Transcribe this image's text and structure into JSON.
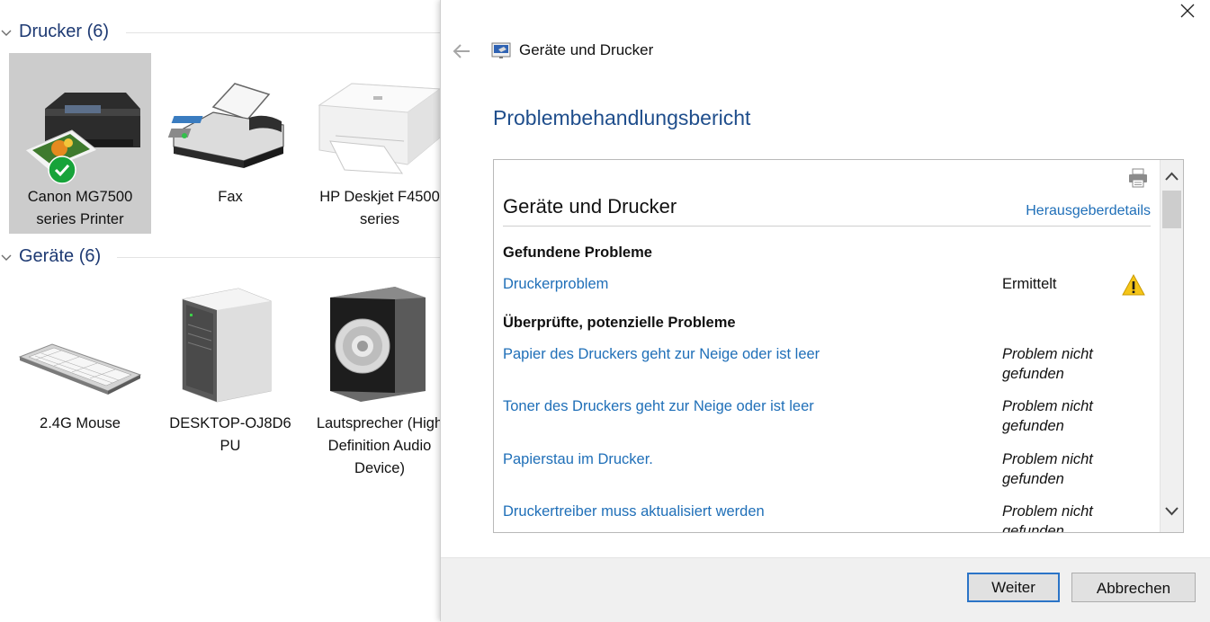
{
  "explorer": {
    "sections": [
      {
        "title": "Drucker (6)"
      },
      {
        "title": "Geräte (6)"
      }
    ],
    "printers": [
      {
        "label": "Canon MG7500 series Printer",
        "selected": true,
        "default": true
      },
      {
        "label": "Fax"
      },
      {
        "label": "HP Deskjet F4500 series"
      }
    ],
    "devices": [
      {
        "label": "2.4G Mouse"
      },
      {
        "label": "DESKTOP-OJ8D6 PU"
      },
      {
        "label": "Lautsprecher (High Definition Audio Device)"
      }
    ]
  },
  "dialog": {
    "window_title": "Geräte und Drucker",
    "heading": "Problembehandlungsbericht",
    "report": {
      "title": "Geräte und Drucker",
      "publisher_link": "Herausgeberdetails",
      "found_header": "Gefundene Probleme",
      "found": [
        {
          "name": "Druckerproblem",
          "status": "Ermittelt",
          "icon": "warning-icon"
        }
      ],
      "checked_header": "Überprüfte, potenzielle Probleme",
      "checked": [
        {
          "name": "Papier des Druckers geht zur Neige oder ist leer",
          "status": "Problem nicht gefunden"
        },
        {
          "name": "Toner des Druckers geht zur Neige oder ist leer",
          "status": "Problem nicht gefunden"
        },
        {
          "name": "Papierstau im Drucker.",
          "status": "Problem nicht gefunden"
        },
        {
          "name": "Druckertreiber muss aktualisiert werden",
          "status": "Problem nicht gefunden"
        }
      ]
    },
    "buttons": {
      "next": "Weiter",
      "cancel": "Abbrechen"
    }
  },
  "colors": {
    "accent": "#1f4e8c",
    "link": "#1f6fb8",
    "section_header": "#1e3a73",
    "selected_bg": "#cccccc"
  }
}
